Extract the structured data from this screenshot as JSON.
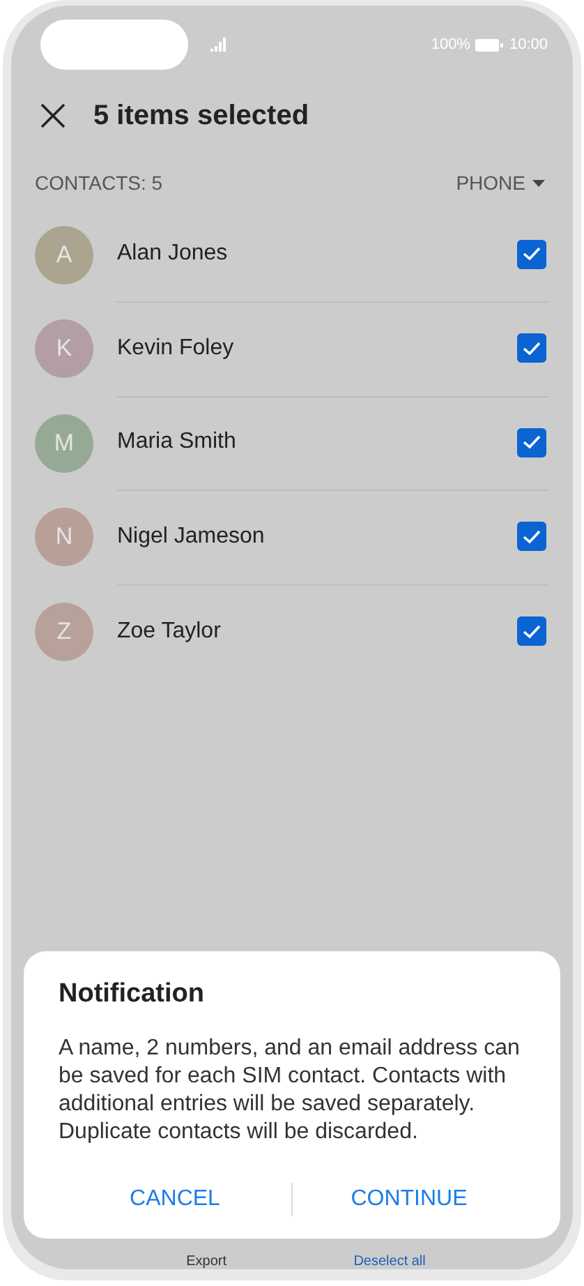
{
  "status_bar": {
    "battery": "100%",
    "time": "10:00"
  },
  "header": {
    "title": "5 items selected"
  },
  "list_header": {
    "count_label": "CONTACTS: 5",
    "filter": "PHONE"
  },
  "contacts": [
    {
      "initial": "A",
      "name": "Alan Jones",
      "color": "#aba58f",
      "checked": true
    },
    {
      "initial": "K",
      "name": "Kevin Foley",
      "color": "#b39ea6",
      "checked": true
    },
    {
      "initial": "M",
      "name": "Maria Smith",
      "color": "#96a994",
      "checked": true
    },
    {
      "initial": "N",
      "name": "Nigel Jameson",
      "color": "#b8a099",
      "checked": true
    },
    {
      "initial": "Z",
      "name": "Zoe Taylor",
      "color": "#b9a19b",
      "checked": true
    }
  ],
  "bottom_bar": [
    {
      "label": "Export",
      "kind": "plain"
    },
    {
      "label": "Deselect all",
      "kind": "link"
    }
  ],
  "dialog": {
    "title": "Notification",
    "message": "A name, 2 numbers, and an email address can be saved for each SIM contact. Contacts with additional entries will be saved separately. Duplicate contacts will be discarded.",
    "buttons": [
      "CANCEL",
      "CONTINUE"
    ]
  }
}
